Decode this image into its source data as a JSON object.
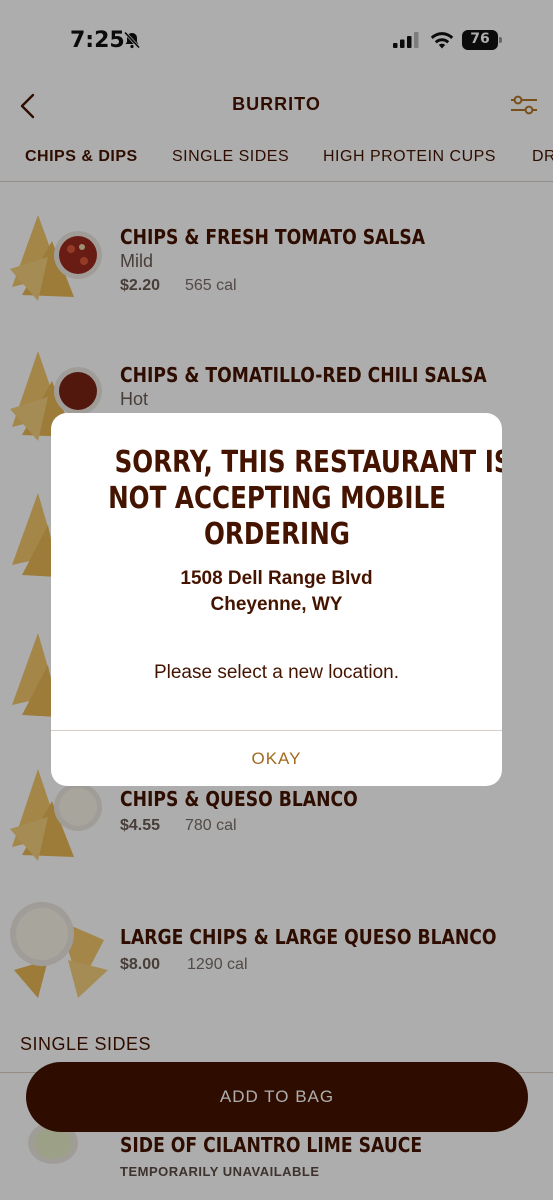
{
  "status_bar": {
    "time": "7:25",
    "battery": "76"
  },
  "header": {
    "title": "BURRITO"
  },
  "tabs": [
    {
      "label": "CHIPS & DIPS",
      "active": true
    },
    {
      "label": "SINGLE SIDES",
      "active": false
    },
    {
      "label": "HIGH PROTEIN CUPS",
      "active": false
    },
    {
      "label": "DR",
      "active": false
    }
  ],
  "menu_items": [
    {
      "name": "CHIPS & FRESH TOMATO SALSA",
      "sub": "Mild",
      "price": "$2.20",
      "cal": "565 cal"
    },
    {
      "name": "CHIPS & TOMATILLO-RED CHILI SALSA",
      "sub": "Hot"
    },
    {
      "name": "CHIPS & QUESO BLANCO",
      "price": "$4.55",
      "cal": "780 cal"
    },
    {
      "name": "LARGE CHIPS & LARGE QUESO BLANCO",
      "price": "$8.00",
      "cal": "1290 cal"
    }
  ],
  "single_sides": {
    "label": "SINGLE SIDES",
    "first_item": {
      "name": "SIDE OF CILANTRO LIME SAUCE",
      "status": "TEMPORARILY UNAVAILABLE"
    }
  },
  "add_to_bag": {
    "label": "ADD TO BAG"
  },
  "dialog": {
    "title_lines": [
      "SORRY, THIS RESTAURANT IS",
      "NOT ACCEPTING MOBILE",
      "ORDERING"
    ],
    "address_line1": "1508 Dell Range Blvd",
    "address_line2": "Cheyenne, WY",
    "message": "Please select a new location.",
    "button": "OKAY"
  },
  "colors": {
    "brand_brown": "#451400",
    "okay_gold": "#a16a1e"
  },
  "icons": [
    "back-chevron-icon",
    "filter-icon",
    "bell-slash-icon",
    "signal-icon",
    "wifi-icon",
    "battery-icon"
  ]
}
